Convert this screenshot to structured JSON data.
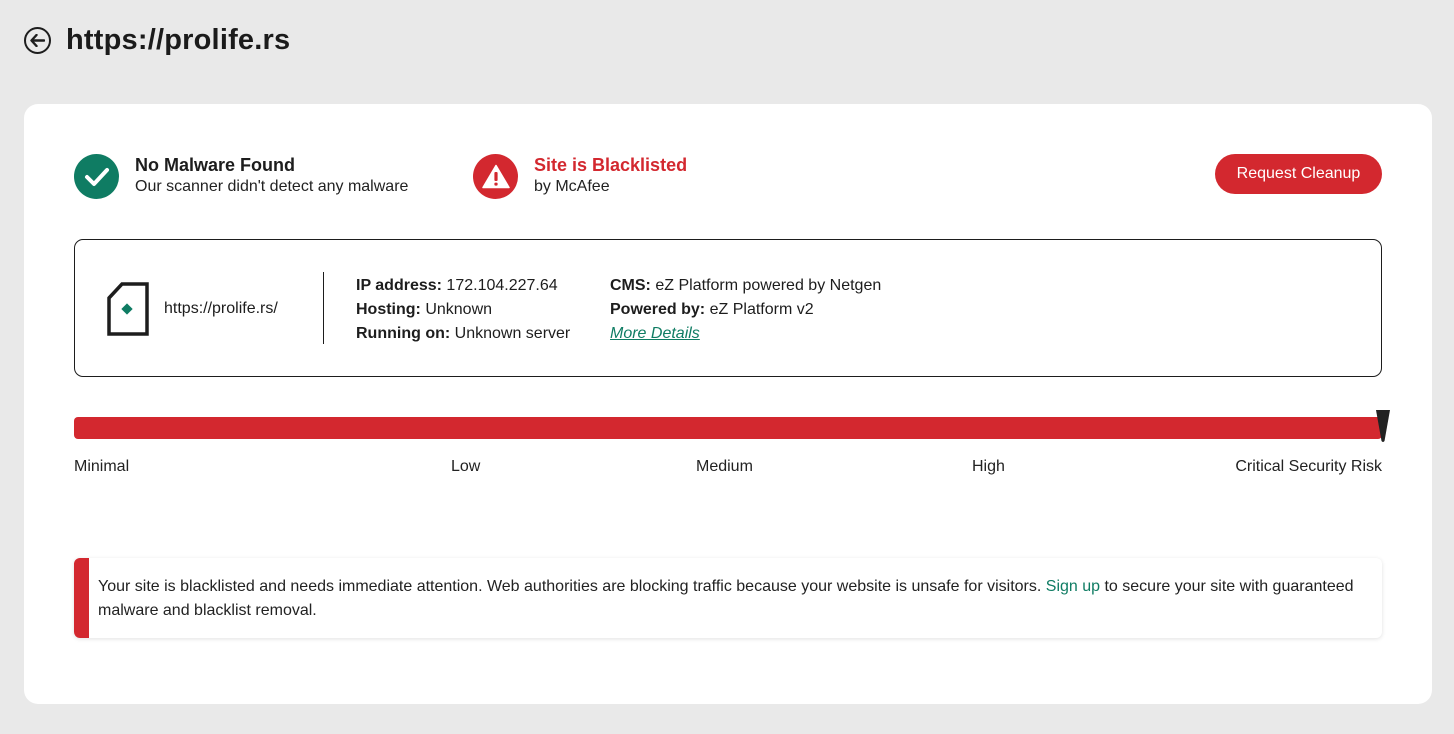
{
  "header": {
    "title": "https://prolife.rs",
    "back_icon": "arrow-left-icon"
  },
  "status": {
    "malware": {
      "title": "No Malware Found",
      "subtitle": "Our scanner didn't detect any malware",
      "icon": "checkmark-icon",
      "color": "#0f7c63"
    },
    "blacklist": {
      "title": "Site is Blacklisted",
      "subtitle": "by McAfee",
      "icon": "warning-icon",
      "color": "#d3282f"
    }
  },
  "actions": {
    "request_cleanup": "Request Cleanup"
  },
  "site_info": {
    "url": "https://prolife.rs/",
    "ip_label": "IP address:",
    "ip_value": "172.104.227.64",
    "hosting_label": "Hosting:",
    "hosting_value": "Unknown",
    "running_label": "Running on:",
    "running_value": "Unknown server",
    "cms_label": "CMS:",
    "cms_value": "eZ Platform powered by Netgen",
    "powered_label": "Powered by:",
    "powered_value": "eZ Platform v2",
    "more_details": "More Details"
  },
  "risk": {
    "labels": [
      "Minimal",
      "Low",
      "Medium",
      "High",
      "Critical Security Risk"
    ],
    "level": 1.0,
    "color": "#d3282f"
  },
  "alert": {
    "text_before": "Your site is blacklisted and needs immediate attention. Web authorities are blocking traffic because your website is unsafe for visitors. ",
    "link": "Sign up",
    "text_after": " to secure your site with guaranteed malware and blacklist removal."
  },
  "colors": {
    "accent_green": "#0f7c63",
    "danger_red": "#d3282f",
    "background": "#e9e9e9"
  }
}
